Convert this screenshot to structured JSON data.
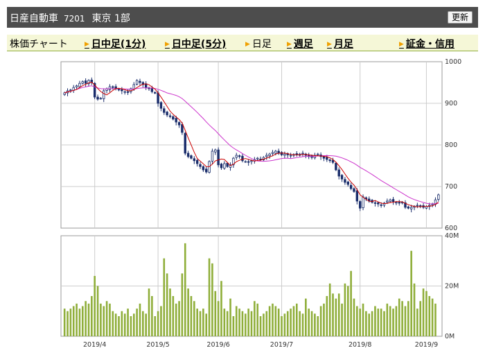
{
  "header": {
    "company": "日産自動車",
    "code": "7201",
    "market": "東京 1部",
    "refresh_label": "更新"
  },
  "nav": {
    "items": [
      {
        "label": "株価チャート",
        "link": false,
        "arrow": false
      },
      {
        "label": "日中足(1分)",
        "link": true,
        "arrow": true
      },
      {
        "label": "日中足(5分)",
        "link": true,
        "arrow": true
      },
      {
        "label": "日足",
        "link": false,
        "arrow": true
      },
      {
        "label": "週足",
        "link": true,
        "arrow": true
      },
      {
        "label": "月足",
        "link": true,
        "arrow": true
      },
      {
        "label": "証金・信用",
        "link": true,
        "arrow": true
      }
    ]
  },
  "colors": {
    "candle_up": "#ffffff",
    "candle_down": "#1a2d6b",
    "candle_outline": "#1a2d6b",
    "moving_average_short": "#cc0000",
    "moving_average_long": "#cc33cc",
    "volume_bar": "#8fae3a",
    "volume_profile": "#999999",
    "grid": "#cccccc"
  },
  "chart_data": {
    "type": "candlestick",
    "price_axis": {
      "min": 600,
      "max": 1000,
      "ticks": [
        1000,
        900,
        800,
        700,
        600
      ]
    },
    "volume_axis": {
      "min": 0,
      "max": 40,
      "unit": "M",
      "ticks": [
        "40M",
        "20M",
        "0M"
      ]
    },
    "x_labels": [
      {
        "label": "2019/4",
        "index": 10
      },
      {
        "label": "2019/5",
        "index": 31
      },
      {
        "label": "2019/6",
        "index": 51
      },
      {
        "label": "2019/7",
        "index": 72
      },
      {
        "label": "2019/8",
        "index": 98
      },
      {
        "label": "2019/9",
        "index": 120
      }
    ],
    "close": [
      925,
      930,
      932,
      938,
      942,
      948,
      952,
      948,
      955,
      950,
      915,
      910,
      912,
      930,
      935,
      940,
      938,
      935,
      932,
      930,
      928,
      926,
      935,
      945,
      955,
      950,
      945,
      938,
      935,
      928,
      925,
      900,
      888,
      878,
      872,
      868,
      862,
      855,
      848,
      830,
      780,
      772,
      768,
      762,
      755,
      748,
      740,
      735,
      760,
      785,
      788,
      752,
      745,
      755,
      748,
      752,
      768,
      775,
      772,
      762,
      760,
      758,
      762,
      765,
      768,
      764,
      770,
      775,
      778,
      782,
      785,
      780,
      776,
      778,
      776,
      775,
      777,
      776,
      778,
      780,
      775,
      772,
      770,
      775,
      778,
      772,
      768,
      765,
      762,
      758,
      740,
      725,
      718,
      710,
      705,
      695,
      688,
      665,
      648,
      675,
      670,
      665,
      662,
      660,
      658,
      655,
      660,
      665,
      668,
      664,
      662,
      660,
      662,
      650,
      648,
      650,
      652,
      655,
      653,
      650,
      652,
      655,
      658,
      668,
      680
    ],
    "volume_M": [
      11,
      10,
      11,
      12,
      13,
      11,
      12,
      14,
      13,
      16,
      24,
      20,
      13,
      12,
      14,
      13,
      10,
      9,
      8,
      10,
      9,
      11,
      8,
      9,
      11,
      13,
      10,
      9,
      19,
      16,
      8,
      10,
      12,
      31,
      25,
      19,
      16,
      13,
      14,
      25,
      37,
      19,
      16,
      14,
      11,
      10,
      11,
      9,
      31,
      29,
      18,
      14,
      22,
      11,
      10,
      15,
      8,
      12,
      11,
      10,
      9,
      11,
      10,
      14,
      13,
      8,
      9,
      10,
      12,
      13,
      12,
      11,
      8,
      9,
      10,
      11,
      12,
      13,
      10,
      9,
      15,
      11,
      10,
      9,
      8,
      12,
      13,
      16,
      21,
      17,
      15,
      17,
      13,
      21,
      20,
      26,
      15,
      12,
      11,
      13,
      10,
      9,
      10,
      12,
      11,
      11,
      10,
      13,
      12,
      11,
      12,
      15,
      14,
      12,
      14,
      34,
      21,
      11,
      14,
      19,
      18,
      16,
      15,
      13
    ]
  }
}
